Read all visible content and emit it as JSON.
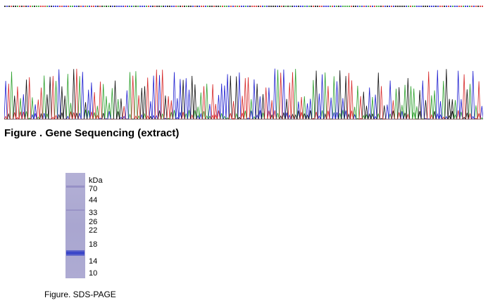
{
  "gene_figure": {
    "caption": "Figure . Gene Sequencing (extract)",
    "trace_colors": {
      "A": "#2ca02c",
      "C": "#1f1fd0",
      "G": "#111111",
      "T": "#d62728"
    }
  },
  "sds_figure": {
    "caption": "Figure. SDS-PAGE",
    "unit": "kDa",
    "markers": [
      "70",
      "44",
      "33",
      "26",
      "22",
      "18",
      "14",
      "10"
    ],
    "band_color": "#2f3cc8",
    "lane_color": "#aeabd3"
  }
}
